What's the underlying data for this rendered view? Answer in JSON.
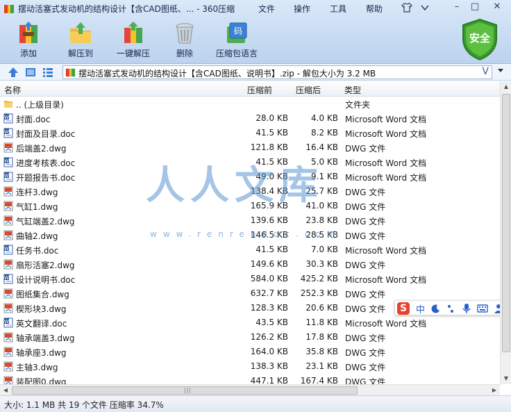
{
  "window": {
    "title": "摆动活塞式发动机的结构设计【含CAD图纸、... - 360压缩",
    "menu": [
      "文件",
      "操作",
      "工具",
      "帮助"
    ],
    "controls": {
      "minimize": "–",
      "maximize": "□",
      "close": "✕"
    }
  },
  "toolbar": {
    "add_label": "添加",
    "extract_label": "解压到",
    "oneclick_label": "一键解压",
    "delete_label": "删除",
    "encoding_label": "压缩包语言",
    "security_label": "安全"
  },
  "address": {
    "path": "摆动活塞式发动机的结构设计【含CAD图纸、说明书】.zip - 解包大小为 3.2 MB",
    "v_mark": "V"
  },
  "columns": {
    "name": "名称",
    "size": "压缩前",
    "packed": "压缩后",
    "type": "类型"
  },
  "files": [
    {
      "name": ".. (上级目录)",
      "size": "",
      "packed": "",
      "type": "文件夹",
      "kind": "folder"
    },
    {
      "name": "封面.doc",
      "size": "28.0 KB",
      "packed": "4.0 KB",
      "type": "Microsoft Word 文档",
      "kind": "doc"
    },
    {
      "name": "封面及目录.doc",
      "size": "41.5 KB",
      "packed": "8.2 KB",
      "type": "Microsoft Word 文档",
      "kind": "doc"
    },
    {
      "name": "后端盖2.dwg",
      "size": "121.8 KB",
      "packed": "16.4 KB",
      "type": "DWG 文件",
      "kind": "dwg"
    },
    {
      "name": "进度考核表.doc",
      "size": "41.5 KB",
      "packed": "5.0 KB",
      "type": "Microsoft Word 文档",
      "kind": "doc"
    },
    {
      "name": "开题报告书.doc",
      "size": "49.0 KB",
      "packed": "9.1 KB",
      "type": "Microsoft Word 文档",
      "kind": "doc"
    },
    {
      "name": "连杆3.dwg",
      "size": "138.4 KB",
      "packed": "25.7 KB",
      "type": "DWG 文件",
      "kind": "dwg"
    },
    {
      "name": "气缸1.dwg",
      "size": "165.9 KB",
      "packed": "41.0 KB",
      "type": "DWG 文件",
      "kind": "dwg"
    },
    {
      "name": "气缸端盖2.dwg",
      "size": "139.6 KB",
      "packed": "23.8 KB",
      "type": "DWG 文件",
      "kind": "dwg"
    },
    {
      "name": "曲轴2.dwg",
      "size": "146.5 KB",
      "packed": "28.5 KB",
      "type": "DWG 文件",
      "kind": "dwg"
    },
    {
      "name": "任务书.doc",
      "size": "41.5 KB",
      "packed": "7.0 KB",
      "type": "Microsoft Word 文档",
      "kind": "doc"
    },
    {
      "name": "扇形活塞2.dwg",
      "size": "149.6 KB",
      "packed": "30.3 KB",
      "type": "DWG 文件",
      "kind": "dwg"
    },
    {
      "name": "设计说明书.doc",
      "size": "584.0 KB",
      "packed": "425.2 KB",
      "type": "Microsoft Word 文档",
      "kind": "doc"
    },
    {
      "name": "图纸集合.dwg",
      "size": "632.7 KB",
      "packed": "252.3 KB",
      "type": "DWG 文件",
      "kind": "dwg"
    },
    {
      "name": "楔形块3.dwg",
      "size": "128.3 KB",
      "packed": "20.6 KB",
      "type": "DWG 文件",
      "kind": "dwg"
    },
    {
      "name": "英文翻译.doc",
      "size": "43.5 KB",
      "packed": "11.8 KB",
      "type": "Microsoft Word 文档",
      "kind": "doc"
    },
    {
      "name": "轴承端盖3.dwg",
      "size": "126.2 KB",
      "packed": "17.8 KB",
      "type": "DWG 文件",
      "kind": "dwg"
    },
    {
      "name": "轴承座3.dwg",
      "size": "164.0 KB",
      "packed": "35.8 KB",
      "type": "DWG 文件",
      "kind": "dwg"
    },
    {
      "name": "主轴3.dwg",
      "size": "138.3 KB",
      "packed": "23.1 KB",
      "type": "DWG 文件",
      "kind": "dwg"
    },
    {
      "name": "装配图0.dwg",
      "size": "447.1 KB",
      "packed": "167.4 KB",
      "type": "DWG 文件",
      "kind": "dwg"
    }
  ],
  "status": {
    "text": "大小: 1.1 MB 共 19 个文件 压缩率 34.7%"
  },
  "watermark": {
    "text": "人人文库",
    "url": "www.renrendoc.com"
  },
  "ime": {
    "logo": "S",
    "mode": "中",
    "icons": [
      "moon-icon",
      "punctuation-icon",
      "mic-icon",
      "keyboard-icon",
      "user-icon"
    ]
  }
}
